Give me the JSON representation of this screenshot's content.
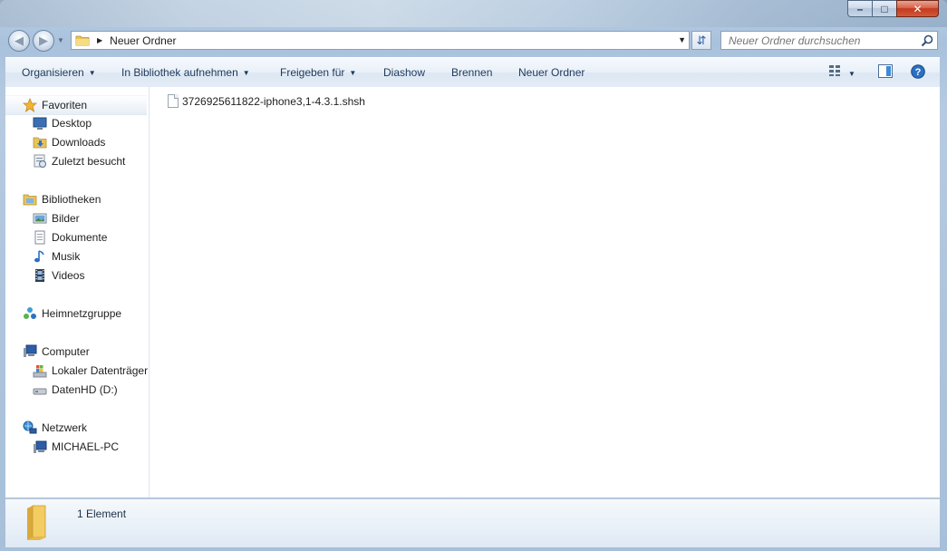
{
  "window": {
    "controls": {
      "minimize": "–",
      "maximize": "□",
      "close": "✕"
    }
  },
  "address_bar": {
    "breadcrumb": "Neuer Ordner",
    "folder_icon": "folder-icon"
  },
  "search": {
    "placeholder": "Neuer Ordner durchsuchen"
  },
  "toolbar": {
    "organize": "Organisieren",
    "add_to_library": "In Bibliothek aufnehmen",
    "share_with": "Freigeben für",
    "slideshow": "Diashow",
    "burn": "Brennen",
    "new_folder": "Neuer Ordner"
  },
  "navigation": {
    "favorites": {
      "label": "Favoriten",
      "items": [
        "Desktop",
        "Downloads",
        "Zuletzt besucht"
      ]
    },
    "libraries": {
      "label": "Bibliotheken",
      "items": [
        "Bilder",
        "Dokumente",
        "Musik",
        "Videos"
      ]
    },
    "homegroup": {
      "label": "Heimnetzgruppe"
    },
    "computer": {
      "label": "Computer",
      "items": [
        "Lokaler Datenträger",
        "DatenHD (D:)"
      ]
    },
    "network": {
      "label": "Netzwerk",
      "items": [
        "MICHAEL-PC"
      ]
    }
  },
  "files": [
    {
      "name": "3726925611822-iphone3,1-4.3.1.shsh",
      "icon": "file-icon"
    }
  ],
  "details_pane": {
    "item_count": "1 Element"
  },
  "colors": {
    "command_text": "#1e395b",
    "glass": "#b6cbe1",
    "close_button": "#c4391d"
  }
}
